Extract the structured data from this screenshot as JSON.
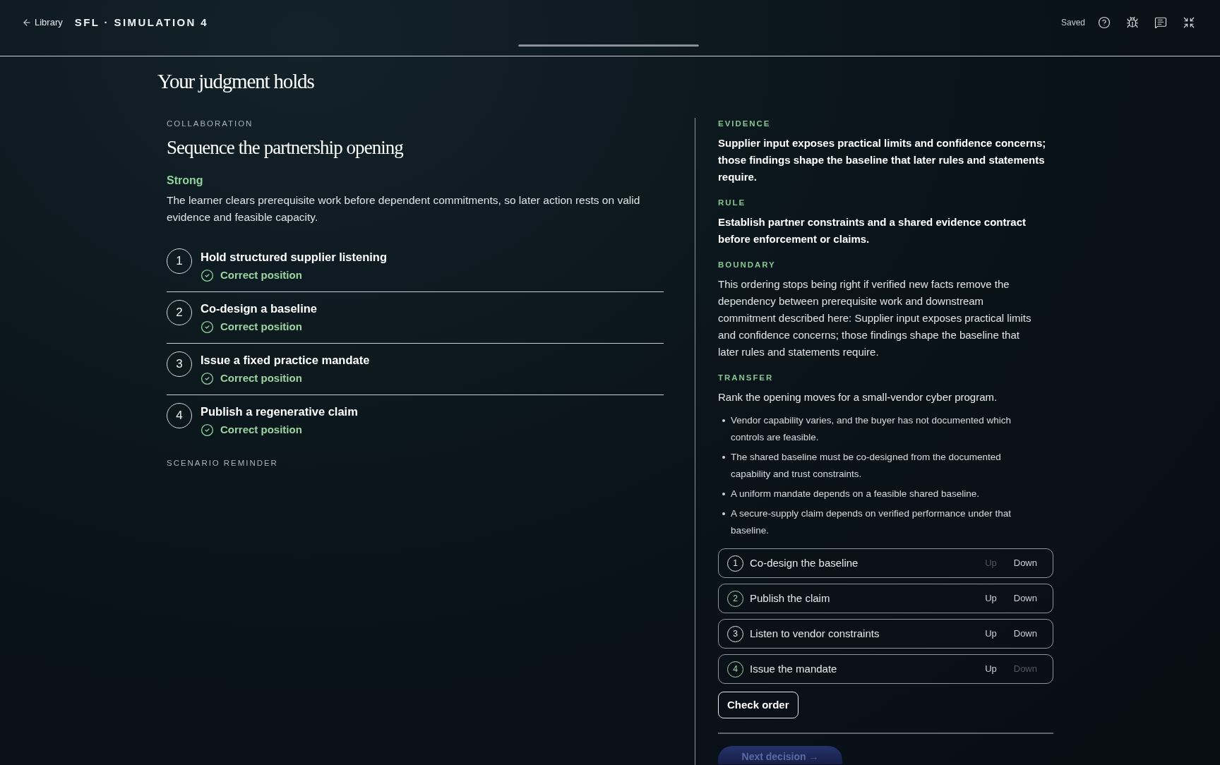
{
  "top_bar": {
    "back_link": {
      "label": "Library"
    },
    "title": "SFL · SIMULATION 4",
    "progress": {
      "level": 1
    },
    "save_status": "Saved"
  },
  "result_title": "Your judgment holds",
  "decision": {
    "category": "COLLABORATION",
    "title": "Sequence the partnership opening",
    "rating": "Strong",
    "summary": "The learner clears prerequisite work before dependent commitments, so later action rests on valid evidence and feasible capacity.",
    "steps": [
      {
        "number": "1",
        "title": "Hold structured supplier listening",
        "status": "Correct position",
        "correct": true
      },
      {
        "number": "2",
        "title": "Co-design a baseline",
        "status": "Correct position",
        "correct": true
      },
      {
        "number": "3",
        "title": "Issue a fixed practice mandate",
        "status": "Correct position",
        "correct": true
      },
      {
        "number": "4",
        "title": "Publish a regenerative claim",
        "status": "Correct position",
        "correct": true
      }
    ],
    "reminder_label": "SCENARIO REMINDER"
  },
  "insight": {
    "sections": [
      {
        "label": "EVIDENCE",
        "kind": "emphasis",
        "text": "Supplier input exposes practical limits and confidence concerns; those findings shape the baseline that later rules and statements require."
      },
      {
        "label": "RULE",
        "kind": "emphasis",
        "text": "Establish partner constraints and a shared evidence contract before enforcement or claims."
      },
      {
        "label": "BOUNDARY",
        "kind": "plain",
        "text": "This ordering stops being right if verified new facts remove the dependency between prerequisite work and downstream commitment described here: Supplier input exposes practical limits and confidence concerns; those findings shape the baseline that later rules and statements require."
      }
    ],
    "transfer": {
      "label": "TRANSFER",
      "prompt": "Rank the opening moves for a small-vendor cyber program.",
      "facts": [
        "Vendor capability varies, and the buyer has not documented which controls are feasible.",
        "The shared baseline must be co-designed from the documented capability and trust constraints.",
        "A uniform mandate depends on a feasible shared baseline.",
        "A secure-supply claim depends on verified performance under that baseline."
      ],
      "order_items": [
        {
          "number": "1",
          "label": "Co-design the baseline",
          "color": "#e2e6ea",
          "up": "Up",
          "down": "Down",
          "up_disabled": true,
          "down_disabled": false
        },
        {
          "number": "2",
          "label": "Publish the claim",
          "color": "#a3d9a8",
          "up": "Up",
          "down": "Down",
          "up_disabled": false,
          "down_disabled": false
        },
        {
          "number": "3",
          "label": "Listen to vendor constraints",
          "color": "#e2e6ea",
          "up": "Up",
          "down": "Down",
          "up_disabled": false,
          "down_disabled": false
        },
        {
          "number": "4",
          "label": "Issue the mandate",
          "color": "#a3d9a8",
          "up": "Up",
          "down": "Down",
          "up_disabled": false,
          "down_disabled": true
        }
      ],
      "check_button": "Check order",
      "next_button": "Next decision →"
    }
  }
}
